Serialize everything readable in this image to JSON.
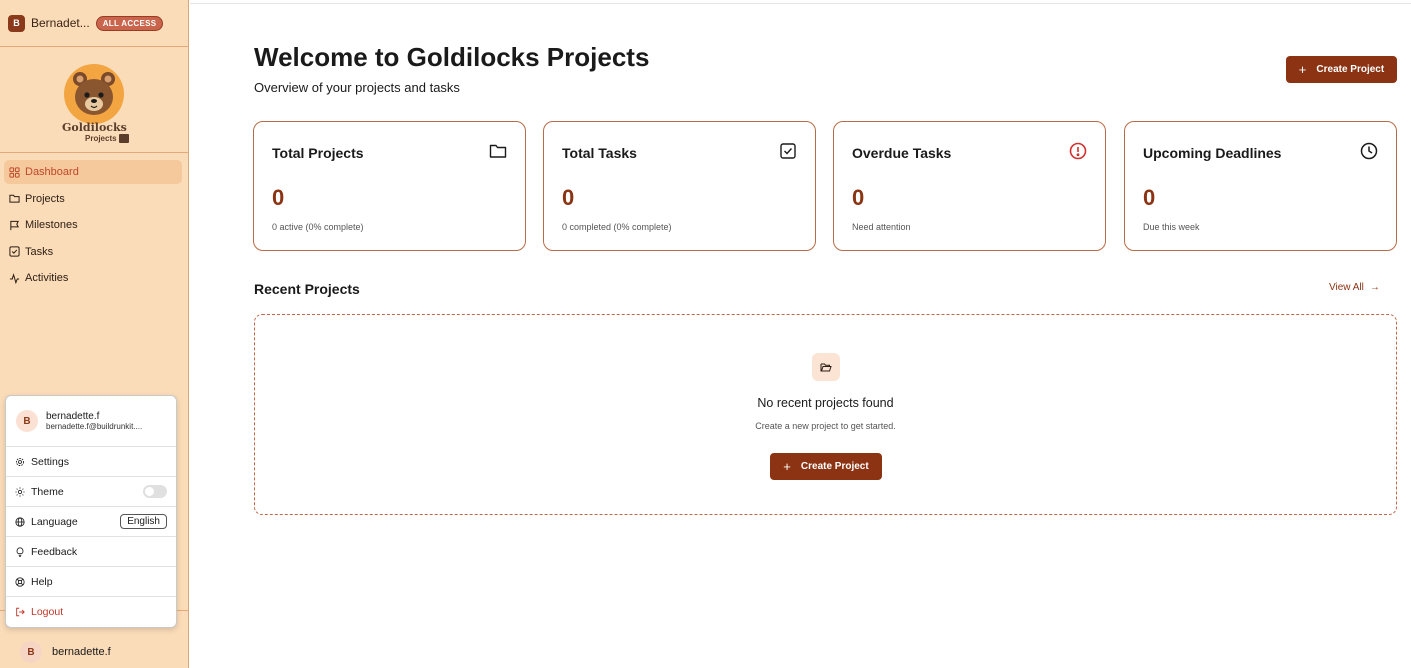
{
  "workspace": {
    "avatar_letter": "B",
    "name": "Bernadet...",
    "badge": "ALL ACCESS"
  },
  "logo": {
    "title": "Goldilocks",
    "subtitle": "Projects"
  },
  "nav": [
    {
      "label": "Dashboard",
      "icon": "grid-icon",
      "active": true
    },
    {
      "label": "Projects",
      "icon": "folder-icon",
      "active": false
    },
    {
      "label": "Milestones",
      "icon": "flag-icon",
      "active": false
    },
    {
      "label": "Tasks",
      "icon": "checkbox-icon",
      "active": false
    },
    {
      "label": "Activities",
      "icon": "activity-icon",
      "active": false
    }
  ],
  "account_menu": {
    "avatar_letter": "B",
    "username": "bernadette.f",
    "email": "bernadette.f@buildrunkit....",
    "settings_label": "Settings",
    "theme_label": "Theme",
    "language_label": "Language",
    "language_value": "English",
    "feedback_label": "Feedback",
    "help_label": "Help",
    "logout_label": "Logout"
  },
  "sidebar_user": {
    "avatar_letter": "B",
    "name": "bernadette.f"
  },
  "header": {
    "title": "Welcome to Goldilocks Projects",
    "subtitle": "Overview of your projects and tasks",
    "create_button": "Create Project",
    "plus": "+"
  },
  "stats": [
    {
      "title": "Total Projects",
      "value": "0",
      "sub": "0 active (0% complete)",
      "icon": "folder-icon"
    },
    {
      "title": "Total Tasks",
      "value": "0",
      "sub": "0 completed (0% complete)",
      "icon": "checkbox-icon"
    },
    {
      "title": "Overdue Tasks",
      "value": "0",
      "sub": "Need attention",
      "icon": "alert-icon"
    },
    {
      "title": "Upcoming Deadlines",
      "value": "0",
      "sub": "Due this week",
      "icon": "clock-icon"
    }
  ],
  "recent": {
    "title": "Recent Projects",
    "view_all": "View All",
    "arrow": "→",
    "empty_title": "No recent projects found",
    "empty_sub": "Create a new project to get started.",
    "create_button": "Create Project",
    "plus": "+"
  },
  "colors": {
    "accent": "#8b3312",
    "sidebar_bg": "#fbdcb8",
    "alert": "#d32f2f"
  }
}
